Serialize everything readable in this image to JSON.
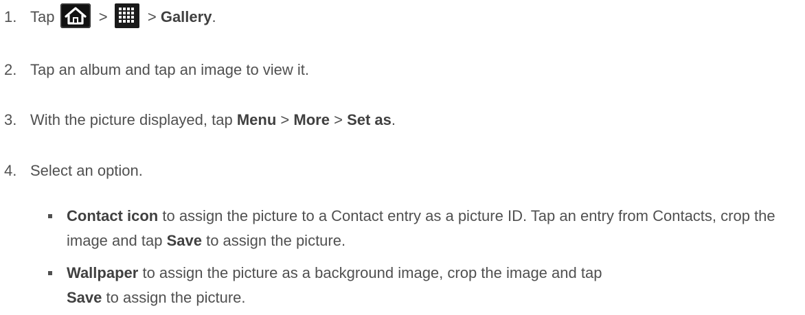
{
  "steps": [
    {
      "number": "1.",
      "text_start": "Tap",
      "sep1": ">",
      "sep2": ">",
      "bold": "Gallery",
      "end": ".",
      "icons": [
        "home-icon",
        "apps-grid-icon"
      ]
    },
    {
      "number": "2.",
      "text": "Tap an album and tap an image to view it."
    },
    {
      "number": "3.",
      "text_start": "With the picture displayed, tap",
      "bold1": "Menu",
      "sep1": ">",
      "bold2": "More",
      "sep2": ">",
      "bold3": "Set as",
      "end": "."
    },
    {
      "number": "4.",
      "text": "Select an option."
    }
  ],
  "options": [
    {
      "bold": "Contact icon",
      "text": "to assign the picture to a Contact entry as a picture ID. Tap an entry from Contacts, crop the image and tap",
      "bold2": "Save",
      "text2": "to assign the picture."
    },
    {
      "bold": "Wallpaper",
      "text": "to assign the picture as a background image, crop the image and tap",
      "bold2": "Save",
      "text2": "to assign the picture."
    }
  ],
  "colors": {
    "text": "#505050",
    "icon_bg": "#111111",
    "icon_fg": "#ffffff"
  }
}
